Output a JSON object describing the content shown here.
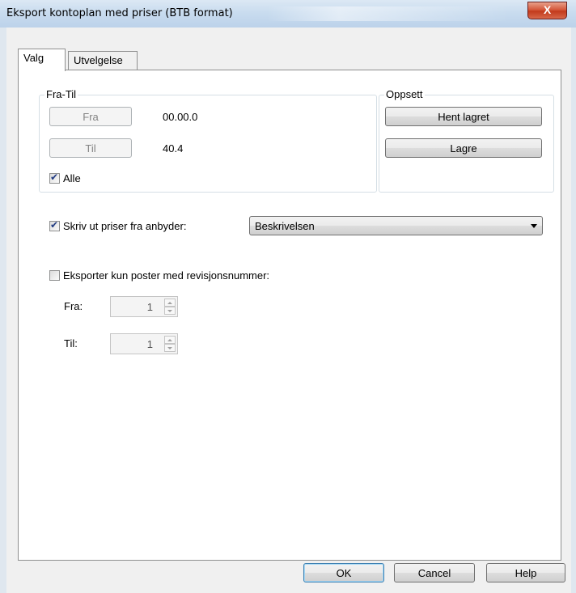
{
  "window": {
    "title": "Eksport kontoplan med priser (BTB format)",
    "close_label": "X"
  },
  "tabs": [
    {
      "label": "Valg"
    },
    {
      "label": "Utvelgelse"
    }
  ],
  "fra_til": {
    "legend": "Fra-Til",
    "fra_button": "Fra",
    "fra_value": "00.00.0",
    "til_button": "Til",
    "til_value": "40.4",
    "alle_label": "Alle",
    "alle_checked": true
  },
  "oppsett": {
    "legend": "Oppsett",
    "hent_button": "Hent lagret",
    "lagre_button": "Lagre"
  },
  "priser": {
    "label": "Skriv ut priser fra anbyder:",
    "checked": true,
    "combo_value": "Beskrivelsen"
  },
  "revisjon": {
    "label": "Eksporter kun poster med revisjonsnummer:",
    "checked": false,
    "fra_label": "Fra:",
    "fra_value": "1",
    "til_label": "Til:",
    "til_value": "1"
  },
  "footer": {
    "ok": "OK",
    "cancel": "Cancel",
    "help": "Help"
  }
}
